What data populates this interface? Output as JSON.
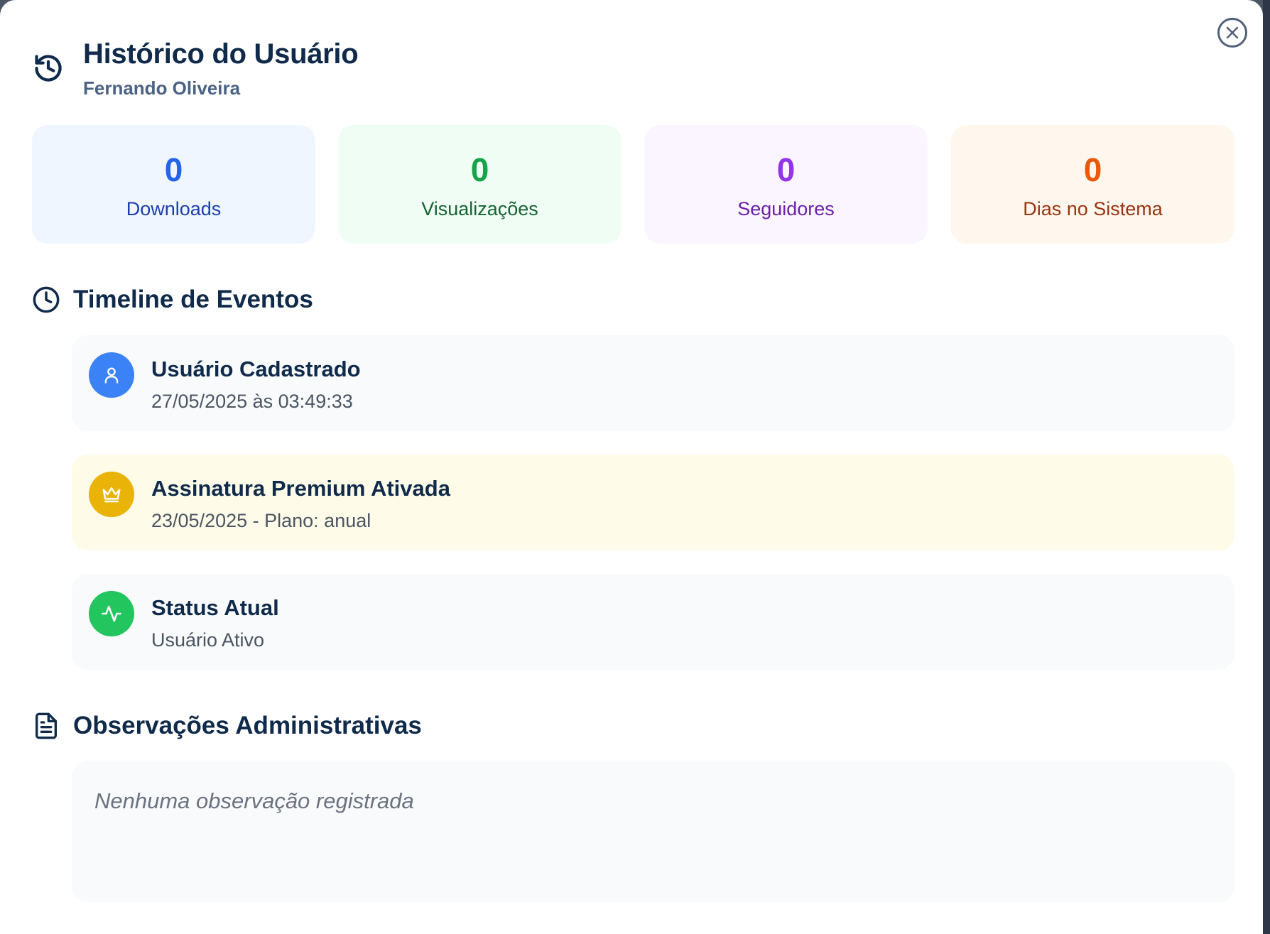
{
  "header": {
    "title": "Histórico do Usuário",
    "subtitle": "Fernando Oliveira",
    "icon": "history-icon",
    "close_icon": "close-icon"
  },
  "stats": [
    {
      "value": "0",
      "label": "Downloads",
      "color": "#2563eb",
      "label_color": "#1e40af",
      "bg": "#eff6ff"
    },
    {
      "value": "0",
      "label": "Visualizações",
      "color": "#16a34a",
      "label_color": "#166534",
      "bg": "#f0fdf4"
    },
    {
      "value": "0",
      "label": "Seguidores",
      "color": "#9333ea",
      "label_color": "#6b21a8",
      "bg": "#faf5ff"
    },
    {
      "value": "0",
      "label": "Dias no Sistema",
      "color": "#ea580c",
      "label_color": "#9a3412",
      "bg": "#fff7ed"
    }
  ],
  "timeline": {
    "title": "Timeline de Eventos",
    "icon": "clock-icon",
    "events": [
      {
        "title": "Usuário Cadastrado",
        "subtitle": "27/05/2025 às 03:49:33",
        "icon": "user-icon",
        "icon_bg": "#3b82f6",
        "bg": "#f8fafc"
      },
      {
        "title": "Assinatura Premium Ativada",
        "subtitle": "23/05/2025 - Plano: anual",
        "icon": "crown-icon",
        "icon_bg": "#eab308",
        "bg": "#fefce8"
      },
      {
        "title": "Status Atual",
        "subtitle": "Usuário Ativo",
        "icon": "activity-icon",
        "icon_bg": "#22c55e",
        "bg": "#f8fafc"
      }
    ]
  },
  "notes": {
    "title": "Observações Administrativas",
    "icon": "document-icon",
    "placeholder_text": "Nenhuma observação registrada"
  }
}
